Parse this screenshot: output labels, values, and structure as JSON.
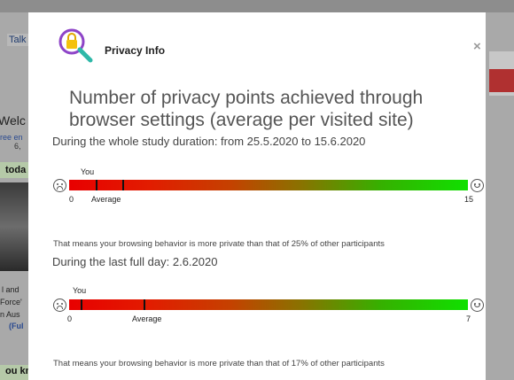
{
  "background": {
    "tab_text": "Talk",
    "welcome_text": "Welc",
    "sub_line1": "ree en",
    "sub_line2": "6,",
    "today_text": "toda",
    "line1": "l and",
    "line2": "Force'",
    "line3": "n Aus",
    "line4": "(Ful",
    "know_text": "ou know ..."
  },
  "modal": {
    "title": "Privacy Info",
    "close_symbol": "×",
    "logo_icon": "magnifier-lock-icon",
    "heading": "Number of privacy points achieved through browser settings (average per visited site)"
  },
  "sections": [
    {
      "label": "During the whole study duration: from 25.5.2020 to 15.6.2020",
      "you_label": "You",
      "average_label": "Average",
      "min": "0",
      "max": "15",
      "you_value": 1,
      "average_value": 2,
      "scale_max": 15,
      "result": "That means your browsing behavior is more private than that of 25% of other participants"
    },
    {
      "label": "During the last full day: 2.6.2020",
      "you_label": "You",
      "average_label": "Average",
      "min": "0",
      "max": "7",
      "you_value": 0.2,
      "average_value": 1.3,
      "scale_max": 7,
      "result": "That means your browsing behavior is more private than that of 17% of other participants"
    }
  ]
}
